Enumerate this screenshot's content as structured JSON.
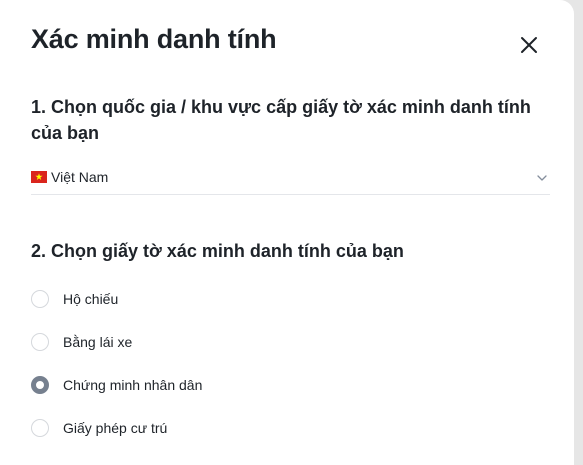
{
  "dialog": {
    "title": "Xác minh danh tính",
    "close_icon": "close-icon"
  },
  "step1": {
    "heading": "1. Chọn quốc gia / khu vực cấp giấy tờ xác minh danh tính của bạn",
    "selected_country": "Việt Nam",
    "flag_icon": "vietnam-flag-icon",
    "dropdown_icon": "chevron-down-icon"
  },
  "step2": {
    "heading": "2. Chọn giấy tờ xác minh danh tính của bạn",
    "options": [
      {
        "label": "Hộ chiếu",
        "checked": false
      },
      {
        "label": "Bằng lái xe",
        "checked": false
      },
      {
        "label": "Chứng minh nhân dân",
        "checked": true
      },
      {
        "label": "Giấy phép cư trú",
        "checked": false
      }
    ]
  },
  "colors": {
    "text": "#1e2329",
    "radio_checked": "#76808f",
    "radio_border": "#d5d8dc",
    "flag_red": "#da251d",
    "flag_star": "#ffff00",
    "overlay": "#e6e6e6"
  }
}
